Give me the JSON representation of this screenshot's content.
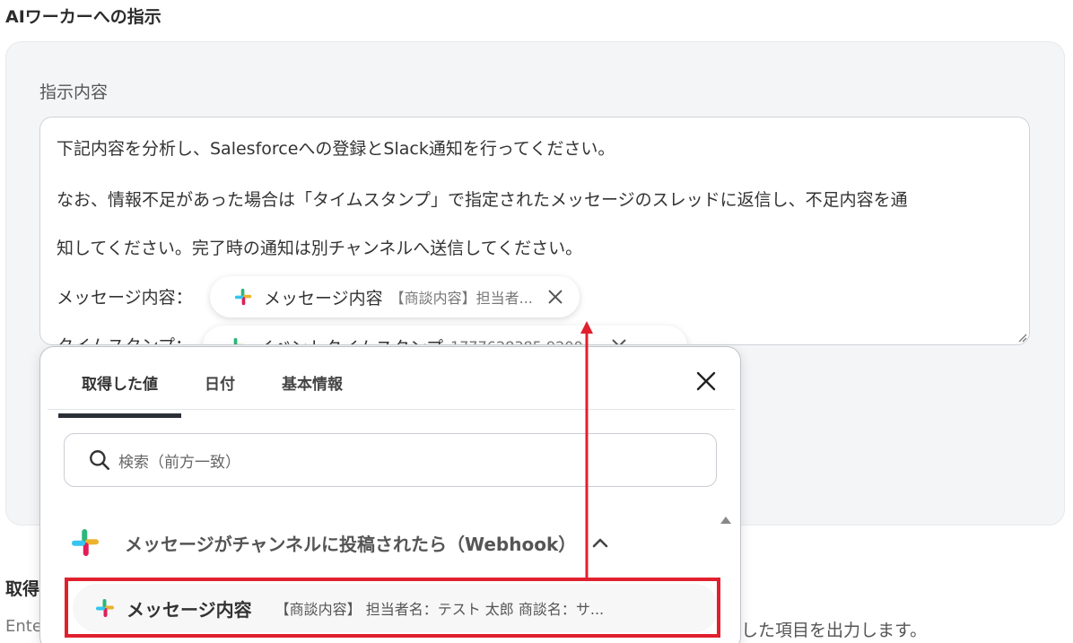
{
  "section": {
    "title": "AIワーカーへの指示"
  },
  "instruction": {
    "label": "指示内容",
    "lines": [
      "下記内容を分析し、Salesforceへの登録とSlack通知を行ってください。",
      "なお、情報不足があった場合は「タイムスタンプ」で指定されたメッセージのスレッドに返信し、不足内容を通",
      "知してください。完了時の通知は別チャンネルへ送信してください。",
      "メッセージ内容：",
      "タイムスタンプ："
    ],
    "chips": [
      {
        "name": "メッセージ内容",
        "preview": "【商談内容】担当者..."
      },
      {
        "name": "イベントタイムスタンプ",
        "preview": "1777628385.9200..."
      }
    ]
  },
  "below": {
    "label": "取得",
    "desc": "Ente",
    "desc_right": "した項目を出力します。"
  },
  "popup": {
    "tabs": [
      "取得した値",
      "日付",
      "基本情報"
    ],
    "active_tab": 0,
    "search_placeholder": "検索（前方一致）",
    "group_title": "メッセージがチャンネルに投稿されたら（Webhook）",
    "row": {
      "name": "メッセージ内容",
      "preview": "【商談内容】 担当者名：テスト 太郎 商談名：サ..."
    }
  },
  "colors": {
    "highlight": "#e0202e",
    "slack_blue": "#36C5F0",
    "slack_green": "#2EB67D",
    "slack_yellow": "#ECB22E",
    "slack_red": "#E01E5A"
  },
  "icons": {
    "slack": "slack-icon",
    "close": "close-icon",
    "search": "search-icon",
    "chevron": "chevron-up-icon"
  }
}
